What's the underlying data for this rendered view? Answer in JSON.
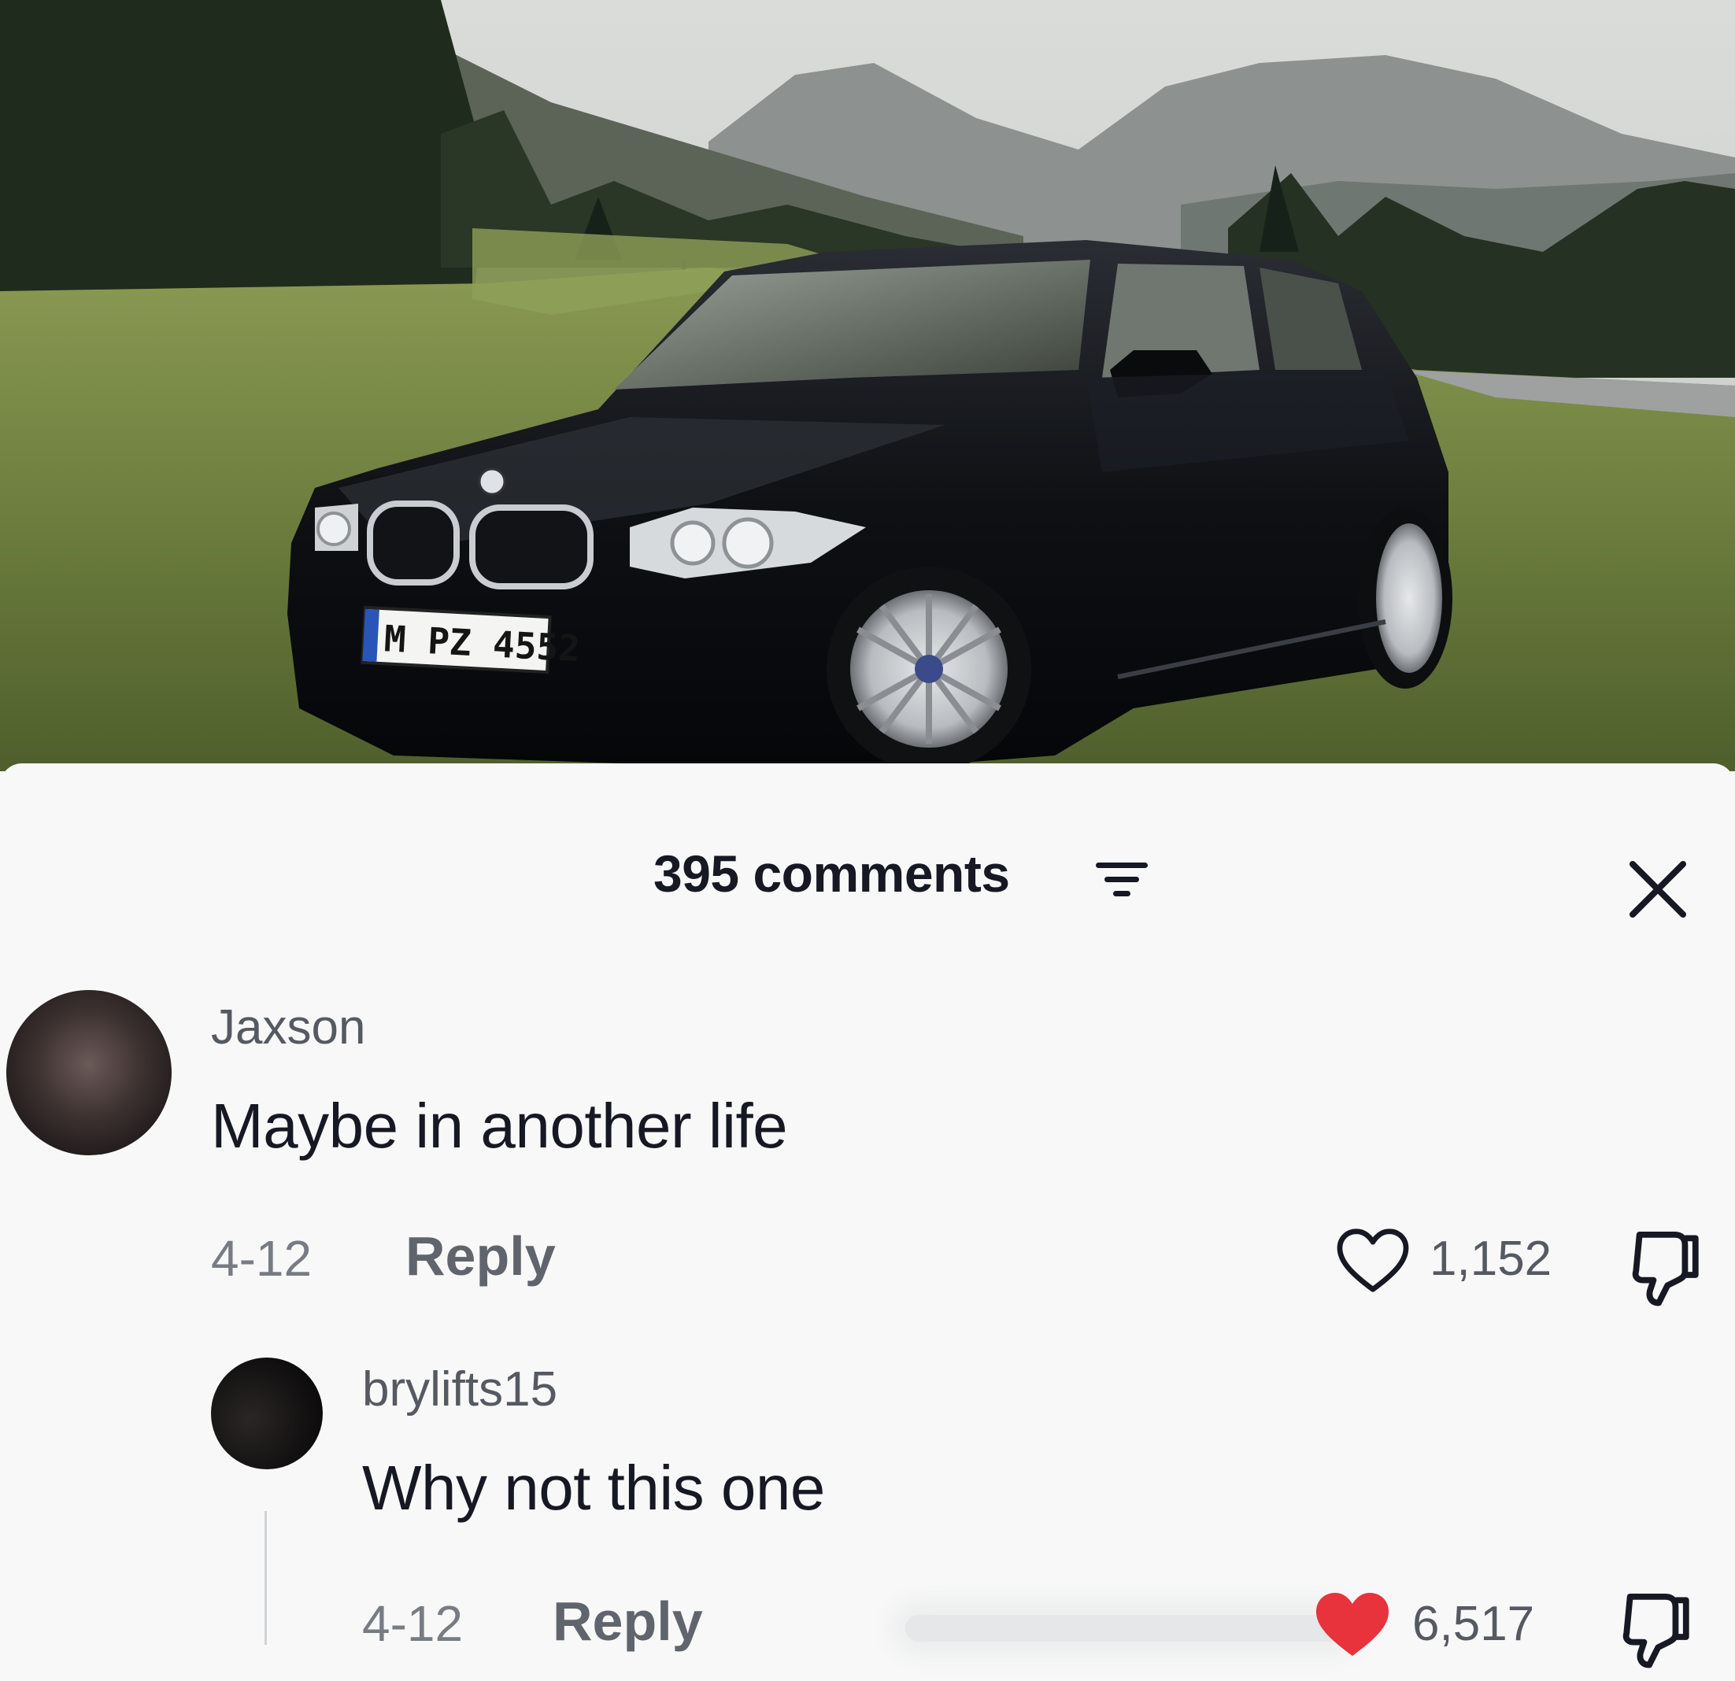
{
  "photo": {
    "plate_text": "M PZ 4552"
  },
  "header": {
    "comment_count": "395 comments",
    "sort_icon": "sort-filter-icon",
    "close_icon": "close-icon"
  },
  "comments": [
    {
      "username": "Jaxson",
      "text": "Maybe in another life",
      "date": "4-12",
      "reply_label": "Reply",
      "likes": "1,152",
      "liked": false
    },
    {
      "username": "brylifts15",
      "text": "Why not this one",
      "date": "4-12",
      "reply_label": "Reply",
      "likes": "6,517",
      "liked": true
    }
  ],
  "colors": {
    "liked_heart": "#e8323c",
    "text_primary": "#161823",
    "text_secondary": "#777c84"
  }
}
